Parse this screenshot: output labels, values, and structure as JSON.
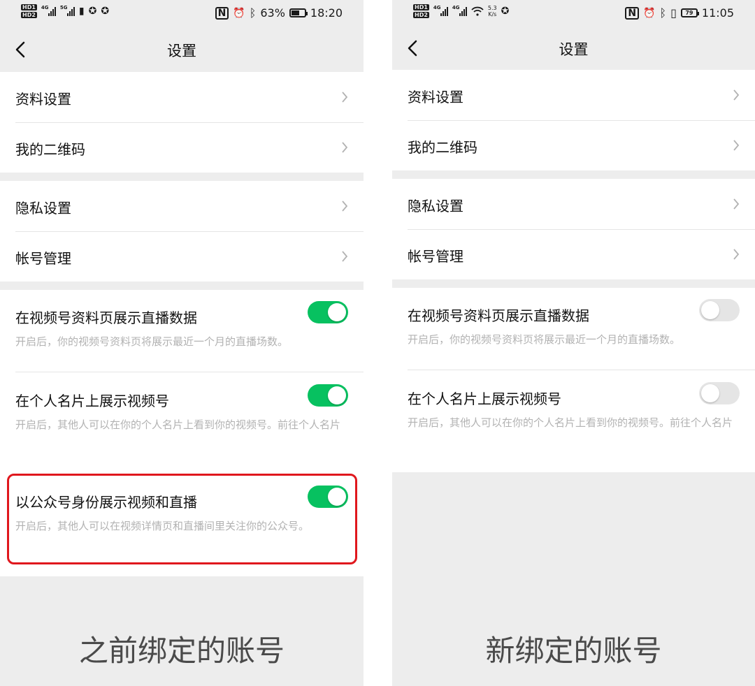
{
  "left": {
    "status": {
      "hd1": "HD1",
      "hd2": "HD2",
      "net1": "4G",
      "net2": "5G",
      "battery_percent": "63%",
      "time": "18:20",
      "nfc_icon": "N",
      "alarm_icon": "⏰",
      "bluetooth_icon": "ᛒ",
      "battery_level": 0.63
    },
    "nav": {
      "back_icon": "chevron-left-icon",
      "title": "设置"
    },
    "group1": [
      {
        "label": "资料设置"
      },
      {
        "label": "我的二维码"
      }
    ],
    "group2": [
      {
        "label": "隐私设置"
      },
      {
        "label": "帐号管理"
      }
    ],
    "toggles": [
      {
        "title": "在视频号资料页展示直播数据",
        "desc": "开启后，你的视频号资料页将展示最近一个月的直播场数。",
        "on": true
      },
      {
        "title": "在个人名片上展示视频号",
        "desc": "开启后，其他人可以在你的个人名片上看到你的视频号。前往个人名片",
        "on": true
      },
      {
        "title": "以公众号身份展示视频和直播",
        "desc": "开启后，其他人可以在视频详情页和直播间里关注你的公众号。",
        "on": true
      }
    ],
    "caption": "之前绑定的账号"
  },
  "right": {
    "status": {
      "hd1": "HD1",
      "hd2": "HD2",
      "net1": "4G",
      "net2": "4G",
      "speed_value": "5.3",
      "speed_unit": "K/s",
      "battery_percent": "79",
      "time": "11:05",
      "nfc_icon": "N",
      "alarm_icon": "⏰",
      "bluetooth_icon": "ᛒ",
      "vibrate_icon": "▯",
      "battery_level": 0.79
    },
    "nav": {
      "back_icon": "chevron-left-icon",
      "title": "设置"
    },
    "group1": [
      {
        "label": "资料设置"
      },
      {
        "label": "我的二维码"
      }
    ],
    "group2": [
      {
        "label": "隐私设置"
      },
      {
        "label": "帐号管理"
      }
    ],
    "toggles": [
      {
        "title": "在视频号资料页展示直播数据",
        "desc": "开启后，你的视频号资料页将展示最近一个月的直播场数。",
        "on": false
      },
      {
        "title": "在个人名片上展示视频号",
        "desc": "开启后，其他人可以在你的个人名片上看到你的视频号。前往个人名片",
        "on": false
      }
    ],
    "caption": "新绑定的账号"
  },
  "colors": {
    "switch_on": "#07c160",
    "switch_off": "#e5e5e5",
    "highlight": "#e0171d",
    "background": "#ededed"
  }
}
